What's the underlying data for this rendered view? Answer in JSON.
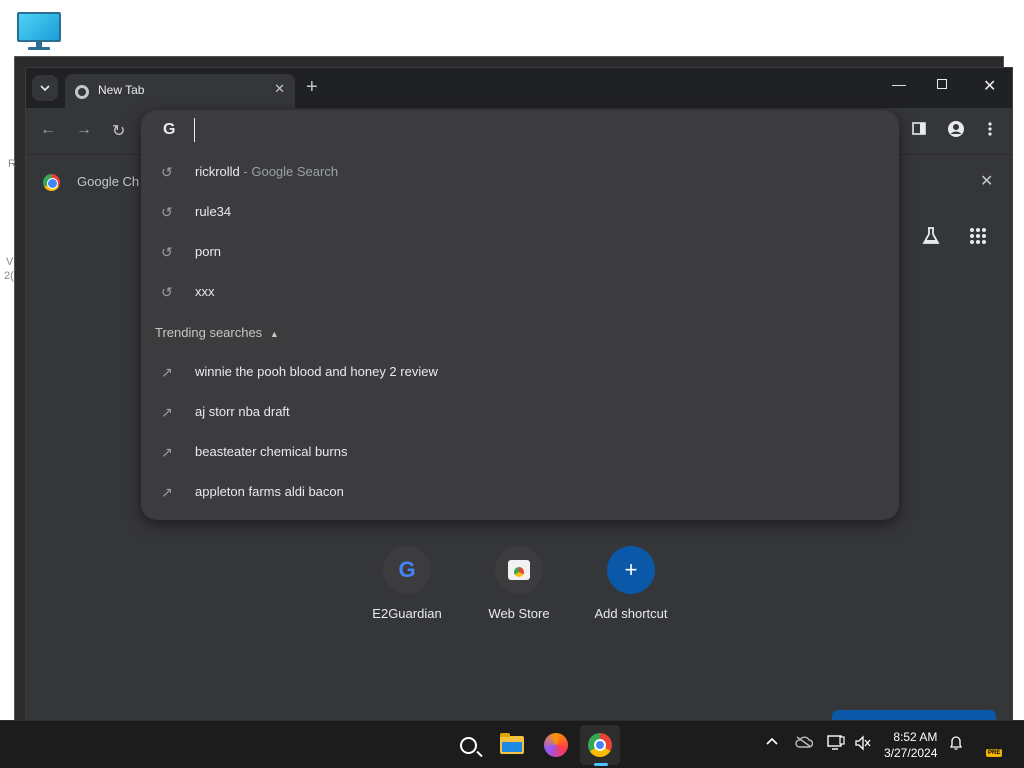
{
  "browser": {
    "tab_title": "New Tab",
    "infobar_text": "Google Ch",
    "new_tab_symbol": "+"
  },
  "omnibox": {
    "search_engine_glyph": "G",
    "value": "",
    "suggestions": [
      {
        "text": "rickrolld",
        "sub": " - Google Search",
        "icon": "history-icon"
      },
      {
        "text": "rule34",
        "sub": "",
        "icon": "history-icon"
      },
      {
        "text": "porn",
        "sub": "",
        "icon": "history-icon"
      },
      {
        "text": "xxx",
        "sub": "",
        "icon": "history-icon"
      }
    ],
    "trending_header": "Trending searches",
    "trending": [
      {
        "text": "winnie the pooh blood and honey 2 review",
        "icon": "trending-icon"
      },
      {
        "text": "aj storr nba draft",
        "icon": "trending-icon"
      },
      {
        "text": "beasteater chemical burns",
        "icon": "trending-icon"
      },
      {
        "text": "appleton farms aldi bacon",
        "icon": "trending-icon"
      }
    ]
  },
  "shortcuts": [
    {
      "label": "E2Guardian",
      "icon": "google-icon"
    },
    {
      "label": "Web Store",
      "icon": "web-store-icon"
    },
    {
      "label": "Add shortcut",
      "icon": "plus-icon"
    }
  ],
  "taskbar": {
    "time": "8:52 AM",
    "date": "3/27/2024",
    "pre_badge": "PRE"
  },
  "background_fragments": [
    "R",
    "V",
    "2("
  ]
}
